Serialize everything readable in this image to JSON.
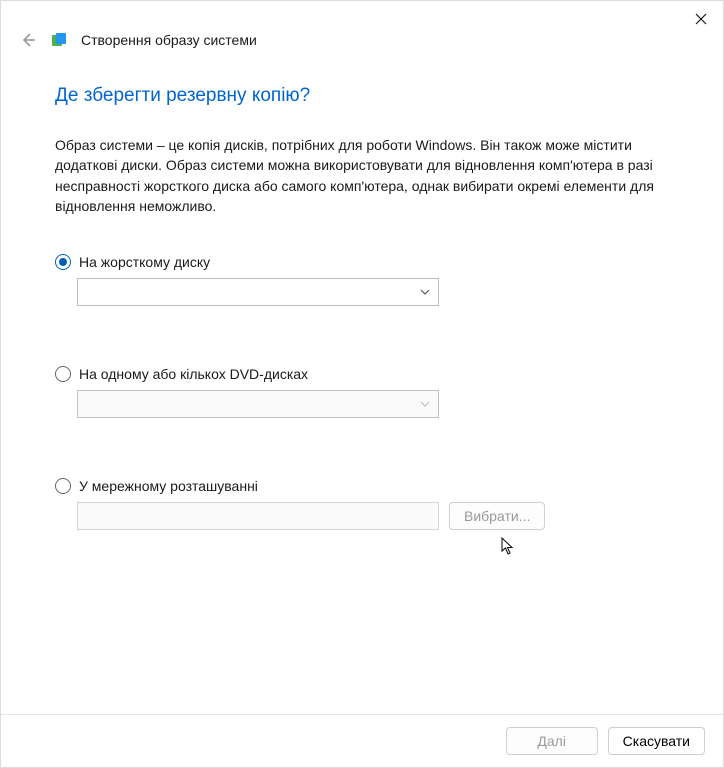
{
  "header": {
    "title": "Створення образу системи"
  },
  "heading": "Де зберегти резервну копію?",
  "description": "Образ системи – це копія дисків, потрібних для роботи Windows. Він також може містити додаткові диски. Образ системи можна використовувати для відновлення комп'ютера в разі несправності жорсткого диска або самого комп'ютера, однак вибирати окремі елементи для відновлення неможливо.",
  "options": {
    "hard_disk": {
      "label": "На жорсткому диску",
      "selected": ""
    },
    "dvd": {
      "label": "На одному або кількох DVD-дисках",
      "selected": ""
    },
    "network": {
      "label": "У мережному розташуванні",
      "value": "",
      "browse_label": "Вибрати..."
    }
  },
  "footer": {
    "next": "Далі",
    "cancel": "Скасувати"
  }
}
